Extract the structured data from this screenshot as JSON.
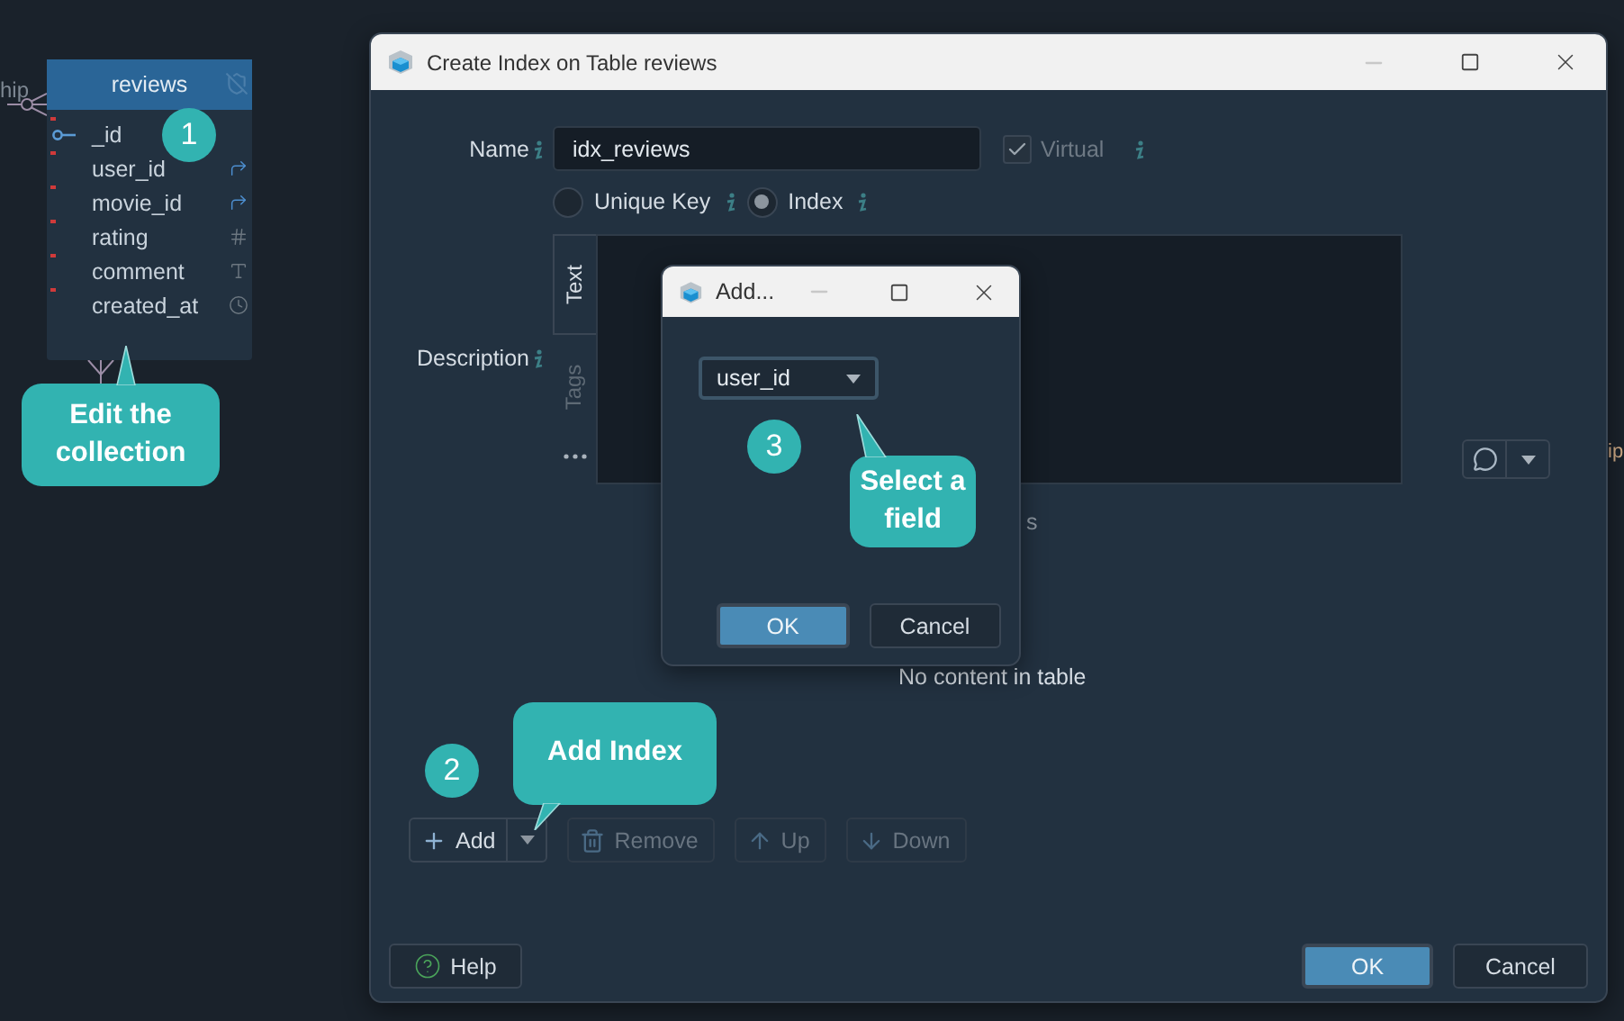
{
  "canvas": {
    "relation_label": "hip",
    "side_label": "ip"
  },
  "entity": {
    "title": "reviews",
    "fields": [
      {
        "name": "_id",
        "kind": "key",
        "required": true
      },
      {
        "name": "user_id",
        "kind": "reference",
        "required": true
      },
      {
        "name": "movie_id",
        "kind": "reference",
        "required": true
      },
      {
        "name": "rating",
        "kind": "number",
        "required": true
      },
      {
        "name": "comment",
        "kind": "text",
        "required": true
      },
      {
        "name": "created_at",
        "kind": "time",
        "required": true
      }
    ]
  },
  "steps": [
    {
      "number": "1",
      "text": "Edit the collection"
    },
    {
      "number": "2",
      "text": "Add Index"
    },
    {
      "number": "3",
      "text": "Select a field"
    }
  ],
  "dialog": {
    "title": "Create Index on Table reviews",
    "name_label": "Name",
    "name_value": "idx_reviews",
    "virtual": {
      "label": "Virtual",
      "checked": true,
      "disabled": true
    },
    "index_types": [
      {
        "label": "Unique Key",
        "selected": false
      },
      {
        "label": "Index",
        "selected": true
      }
    ],
    "description_label": "Description",
    "description_tabs": [
      {
        "label": "Text",
        "selected": true
      },
      {
        "label": "Tags",
        "selected": false
      }
    ],
    "columns_label": "s",
    "empty_text": "No content in table",
    "toolbar": [
      {
        "kind": "add",
        "label": "Add",
        "disabled": false
      },
      {
        "kind": "remove",
        "label": "Remove",
        "disabled": true
      },
      {
        "kind": "up",
        "label": "Up",
        "disabled": true
      },
      {
        "kind": "down",
        "label": "Down",
        "disabled": true
      }
    ],
    "help": "Help",
    "ok": "OK",
    "cancel": "Cancel"
  },
  "add_dialog": {
    "title": "Add...",
    "field_value": "user_id",
    "ok": "OK",
    "cancel": "Cancel"
  }
}
